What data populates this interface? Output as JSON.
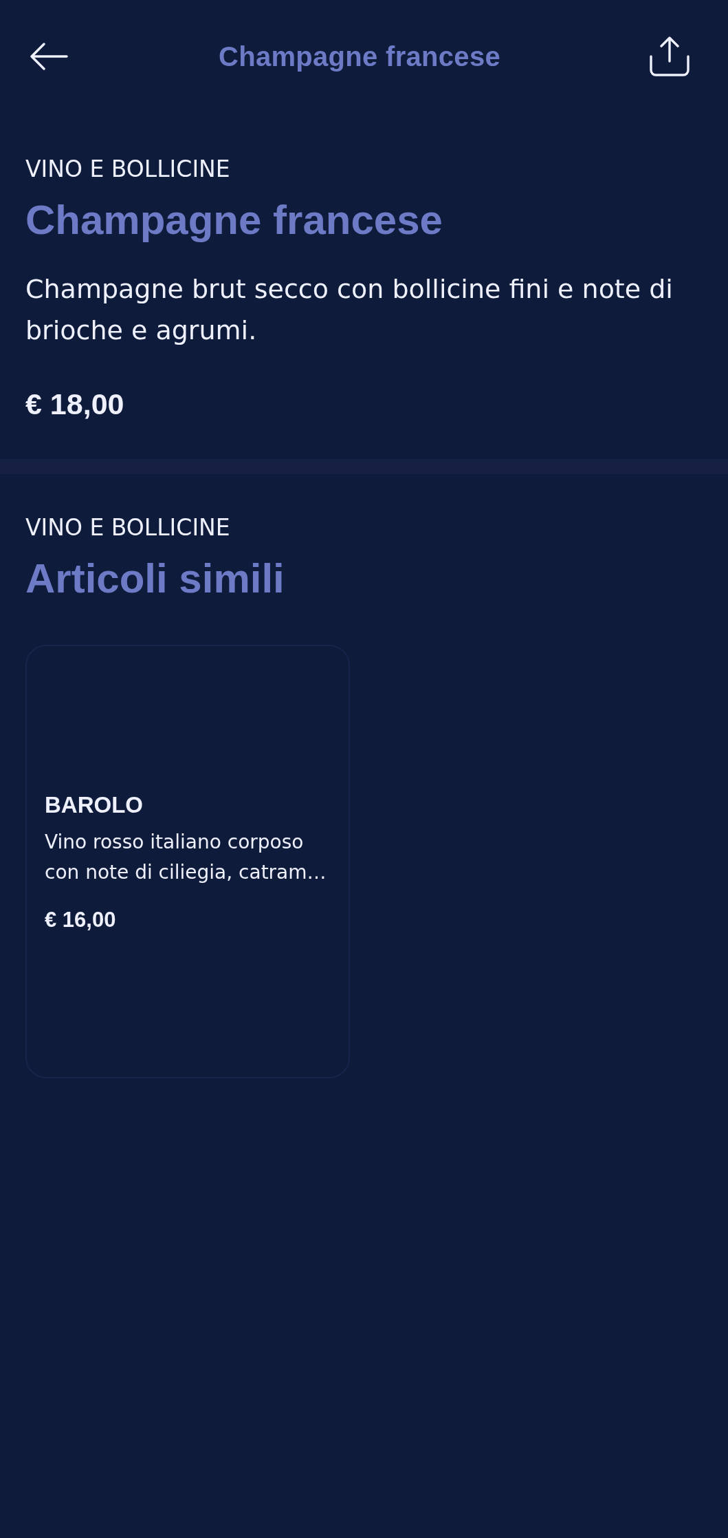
{
  "header": {
    "title": "Champagne francese"
  },
  "product": {
    "category": "VINO E BOLLICINE",
    "name": "Champagne francese",
    "description": "Champagne brut secco con bollicine fini e note di brioche e agrumi.",
    "price": "€ 18,00"
  },
  "similar": {
    "category": "VINO E BOLLICINE",
    "title": "Articoli simili",
    "items": [
      {
        "name": "BAROLO",
        "description": "Vino rosso italiano corposo con note di ciliegia, catram…",
        "price": "€ 16,00"
      }
    ]
  }
}
